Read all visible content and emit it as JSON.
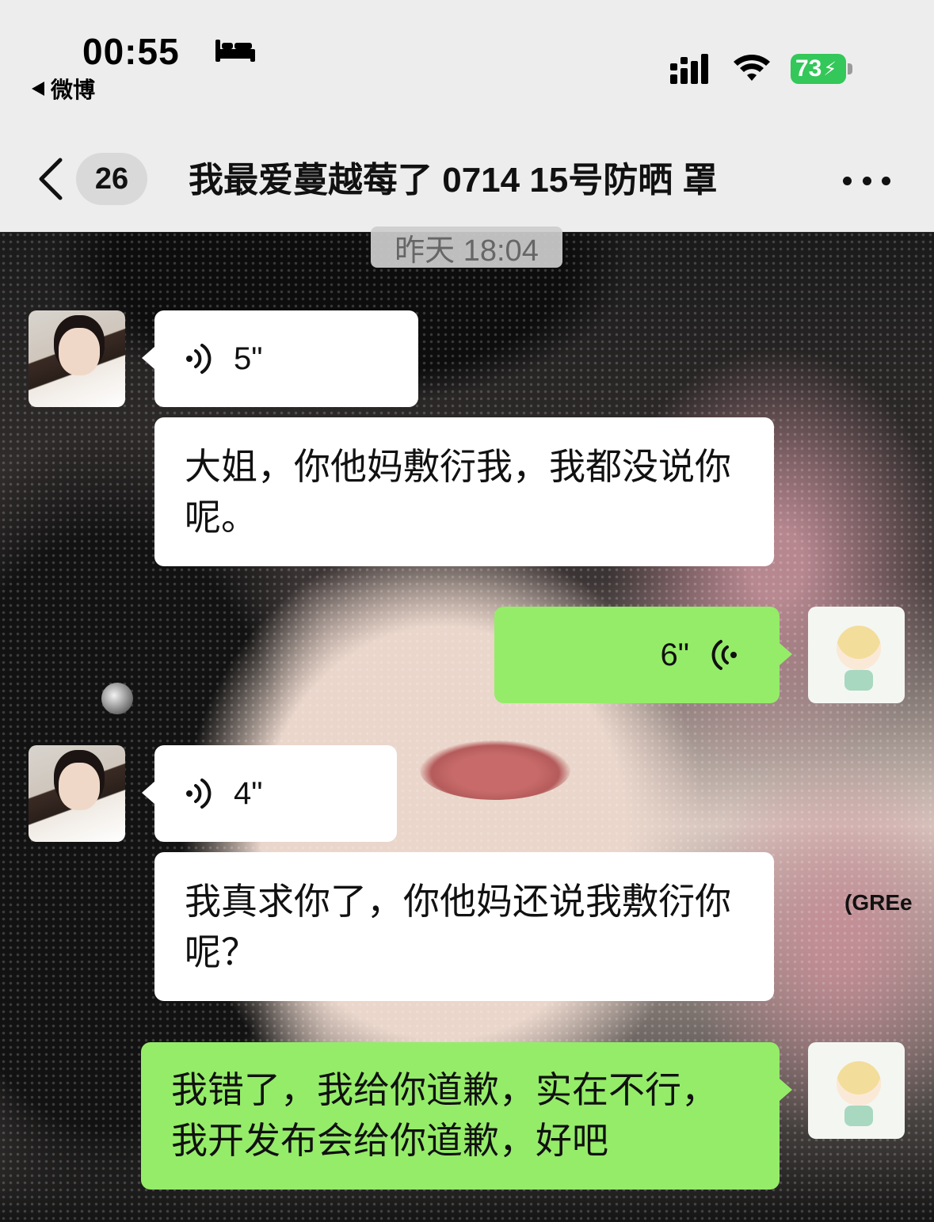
{
  "status_bar": {
    "time": "00:55",
    "back_app": "微博",
    "battery": "73"
  },
  "nav": {
    "unread_count": "26",
    "title": "我最爱蔓越莓了 0714 15号防晒 罩"
  },
  "timestamp": "昨天 18:04",
  "messages": [
    {
      "side": "in",
      "type": "voice",
      "duration": "5\""
    },
    {
      "side": "in",
      "type": "text",
      "text": "大姐，你他妈敷衍我，我都没说你呢。"
    },
    {
      "side": "out",
      "type": "voice",
      "duration": "6\""
    },
    {
      "side": "in",
      "type": "voice",
      "duration": "4\""
    },
    {
      "side": "in",
      "type": "text",
      "text": "我真求你了，你他妈还说我敷衍你呢？"
    },
    {
      "side": "out",
      "type": "text",
      "text": "我错了，我给你道歉，实在不行，我开发布会给你道歉，好吧"
    }
  ],
  "wallpaper_text": "(GREe",
  "colors": {
    "incoming_bubble": "#ffffff",
    "outgoing_bubble": "#95ec69",
    "battery": "#34c759"
  },
  "icons": [
    "bed-icon",
    "signal-icon",
    "wifi-icon",
    "battery-icon",
    "back-chevron-icon",
    "more-icon",
    "voice-wave-icon"
  ]
}
